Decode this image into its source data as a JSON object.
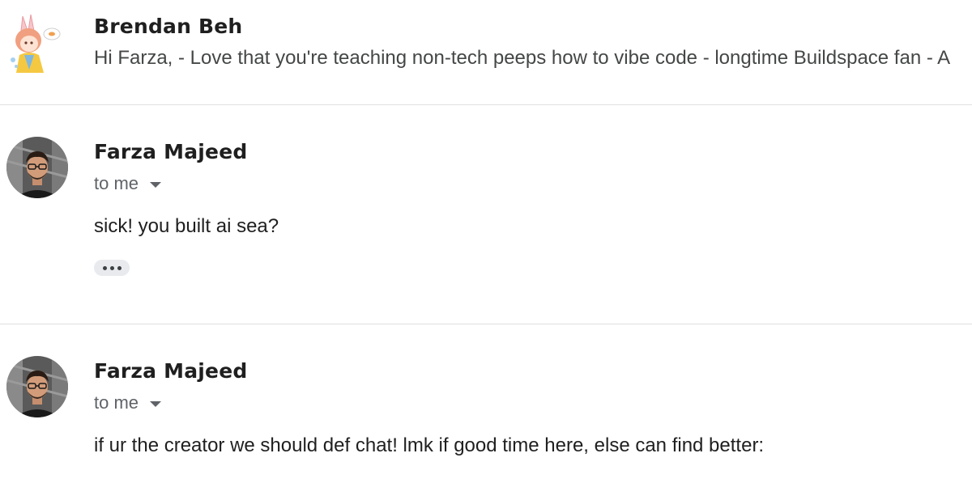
{
  "thread": {
    "messages": [
      {
        "sender": "Brendan Beh",
        "snippet": "Hi Farza, - Love that you're teaching non-tech peeps how to vibe code - longtime Buildspace fan - A",
        "avatar_icon": "anime-character-avatar"
      },
      {
        "sender": "Farza Majeed",
        "recipient": "to me",
        "body": "sick! you built ai sea?",
        "avatar_icon": "person-photo-avatar",
        "trimmed_content_label": "show-trimmed-content"
      },
      {
        "sender": "Farza Majeed",
        "recipient": "to me",
        "body": "if ur the creator we should def chat! lmk if good time here, else can find better:",
        "avatar_icon": "person-photo-avatar"
      }
    ]
  },
  "colors": {
    "sender_text": "#1f1f1f",
    "secondary_text": "#5f6368",
    "divider": "#e0e0e0",
    "trim_button_bg": "#e8eaed"
  }
}
